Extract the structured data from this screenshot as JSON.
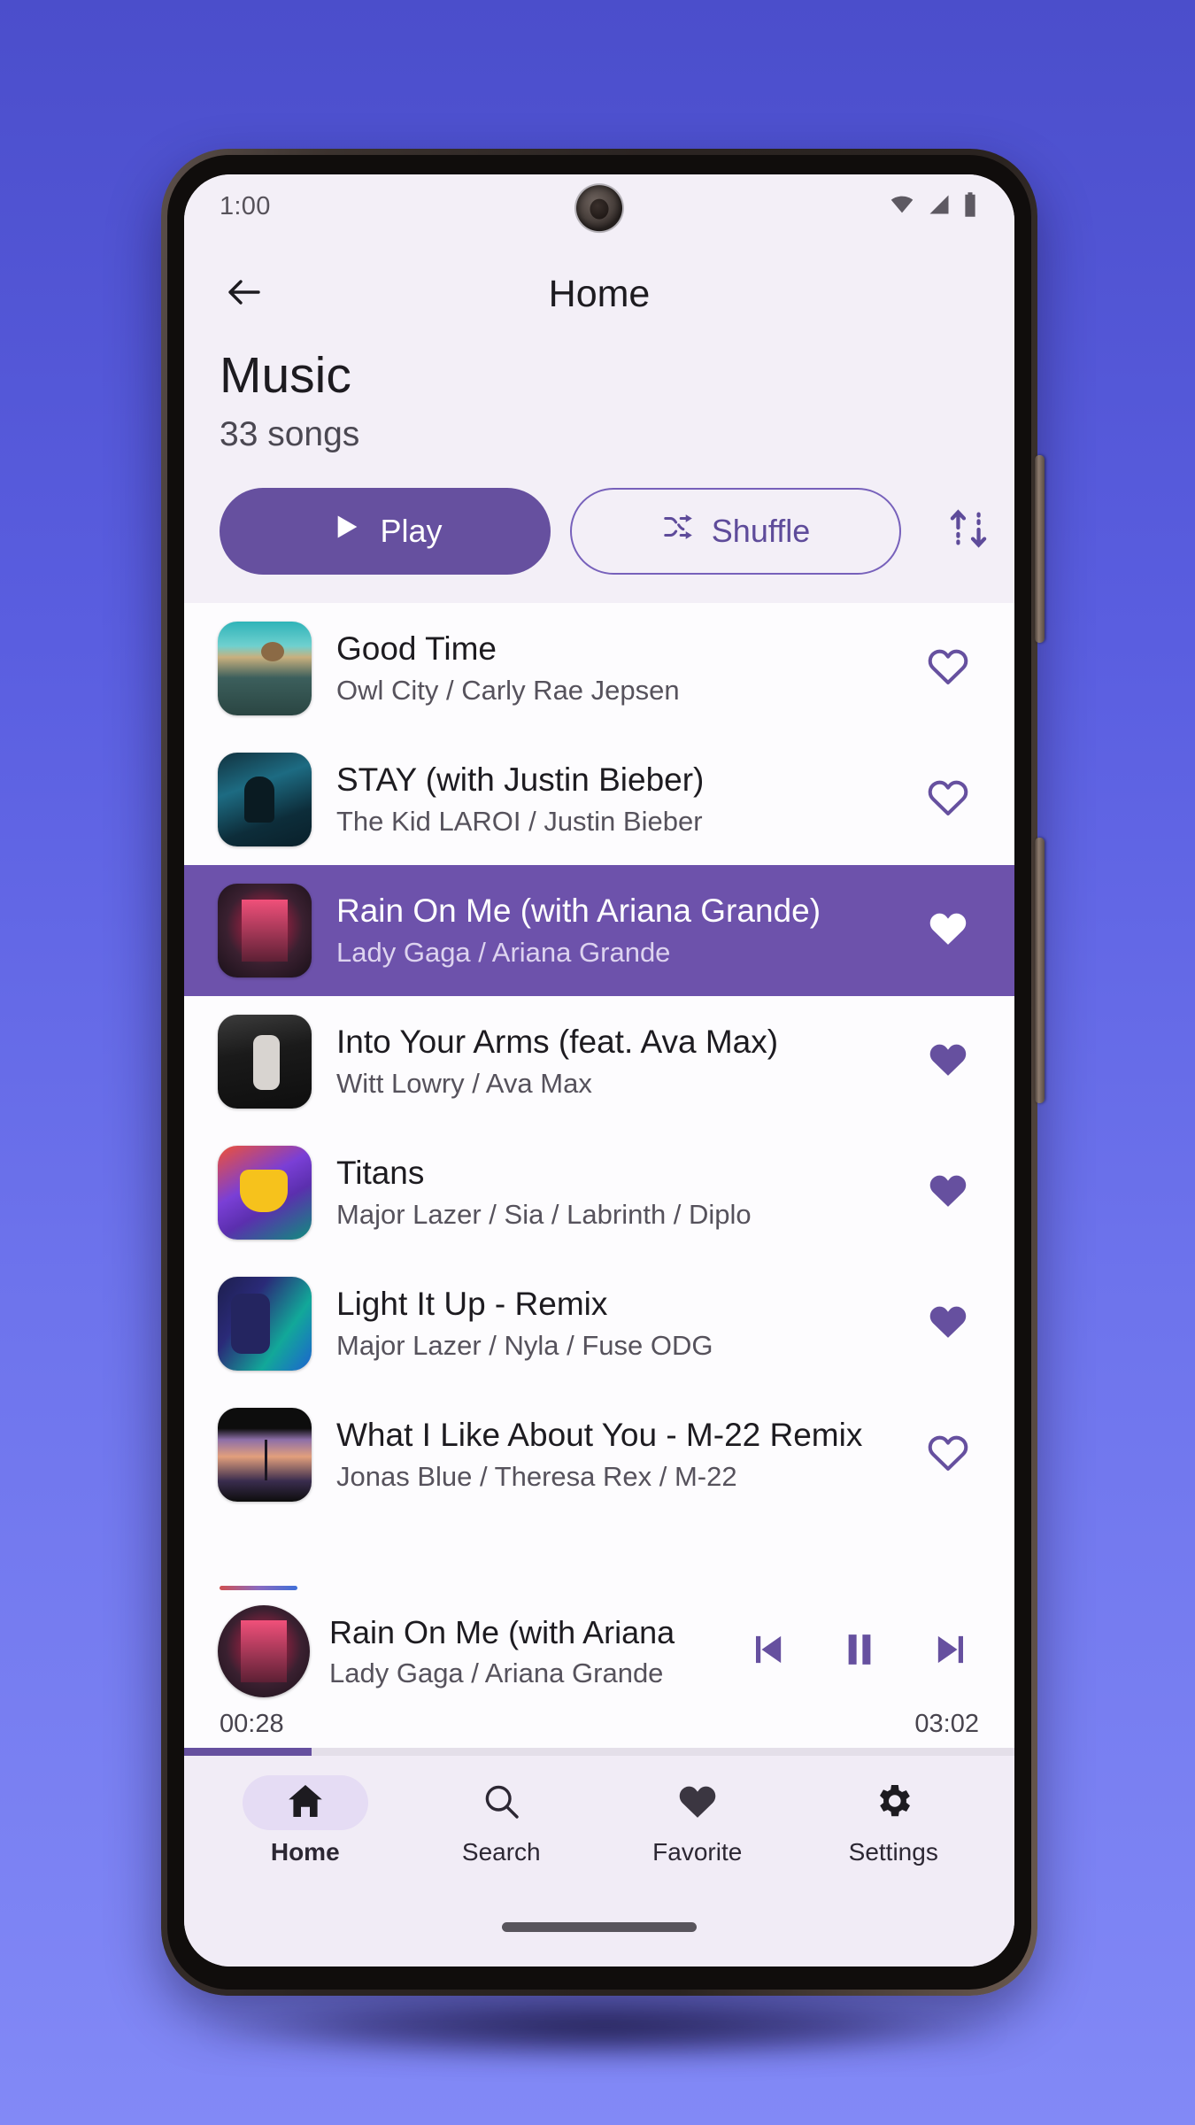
{
  "status_bar": {
    "time": "1:00",
    "icons": [
      "wifi-icon",
      "cellular-signal-icon",
      "battery-icon"
    ]
  },
  "app_bar": {
    "back_icon": "arrow-left-icon",
    "title": "Home"
  },
  "library": {
    "title": "Music",
    "subtitle": "33 songs",
    "play_label": "Play",
    "play_icon": "play-icon",
    "shuffle_label": "Shuffle",
    "shuffle_icon": "shuffle-icon",
    "sort_icon": "sort-arrows-icon"
  },
  "colors": {
    "accent_purple": "#66509f",
    "accent_outline": "#7761bb",
    "active_row": "#6d52ab",
    "screen_bg": "#f3eff7",
    "list_bg": "#fdfcfe",
    "nav_bg": "#f1ecf6",
    "nav_pill": "#e5dcf4",
    "progress_track": "#e4dfe9",
    "page_gradient_top": "#4b4ecb",
    "page_gradient_bottom": "#8289f6"
  },
  "songs": [
    {
      "title": "Good Time",
      "artist": "Owl City / Carly Rae Jepsen",
      "favorite": false,
      "active": false,
      "art": "art-owlcity"
    },
    {
      "title": "STAY (with Justin Bieber)",
      "artist": "The Kid LAROI / Justin Bieber",
      "favorite": false,
      "active": false,
      "art": "art-stay"
    },
    {
      "title": "Rain On Me (with Ariana Grande)",
      "artist": "Lady Gaga / Ariana Grande",
      "favorite": true,
      "active": true,
      "art": "art-rain"
    },
    {
      "title": "Into Your Arms (feat. Ava Max)",
      "artist": "Witt Lowry / Ava Max",
      "favorite": true,
      "active": false,
      "art": "art-intoyourarms"
    },
    {
      "title": "Titans",
      "artist": "Major Lazer / Sia / Labrinth / Diplo",
      "favorite": true,
      "active": false,
      "art": "art-titans"
    },
    {
      "title": "Light It Up - Remix",
      "artist": "Major Lazer / Nyla / Fuse ODG",
      "favorite": true,
      "active": false,
      "art": "art-lightitup"
    },
    {
      "title": "What I Like About You - M-22 Remix",
      "artist": "Jonas Blue / Theresa Rex / M-22",
      "favorite": false,
      "active": false,
      "art": "art-whatilike"
    }
  ],
  "mini_player": {
    "title": "Rain On Me (with Ariana",
    "artist": "Lady Gaga / Ariana Grande",
    "elapsed": "00:28",
    "duration": "03:02",
    "progress_percent": 15.4,
    "previous_icon": "skip-previous-icon",
    "playpause_icon": "pause-icon",
    "next_icon": "skip-next-icon",
    "art": "art-rain"
  },
  "bottom_nav": {
    "items": [
      {
        "label": "Home",
        "icon": "home-icon",
        "active": true
      },
      {
        "label": "Search",
        "icon": "search-icon",
        "active": false
      },
      {
        "label": "Favorite",
        "icon": "heart-icon",
        "active": false
      },
      {
        "label": "Settings",
        "icon": "gear-icon",
        "active": false
      }
    ]
  }
}
